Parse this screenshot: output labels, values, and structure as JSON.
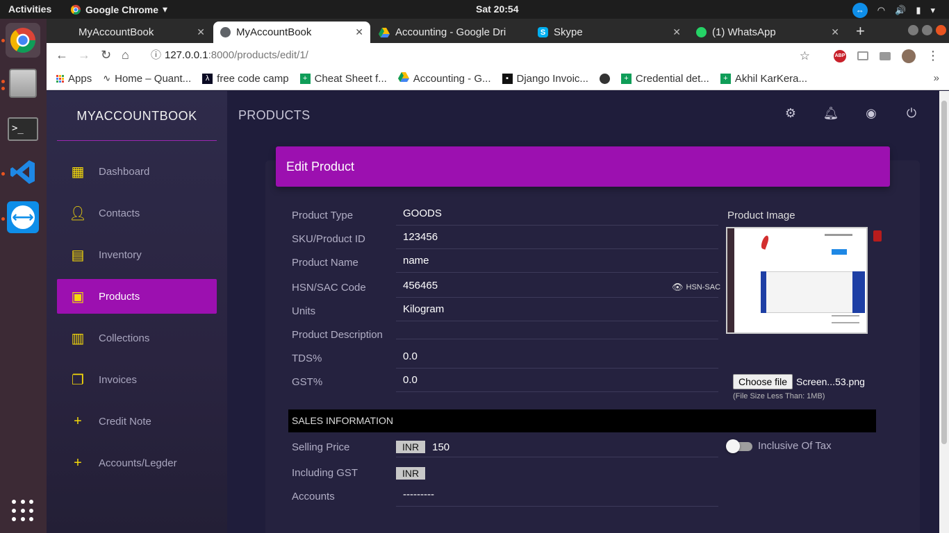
{
  "ubuntu": {
    "activities": "Activities",
    "app_name": "Google Chrome",
    "clock": "Sat 20:54"
  },
  "tabs": [
    {
      "title": "MyAccountBook",
      "icon": "blank-page-icon",
      "active": false
    },
    {
      "title": "MyAccountBook",
      "icon": "globe-icon",
      "active": true
    },
    {
      "title": "Accounting - Google Dri",
      "icon": "google-drive-icon",
      "active": false
    },
    {
      "title": "Skype",
      "icon": "skype-icon",
      "active": false
    },
    {
      "title": "(1) WhatsApp",
      "icon": "whatsapp-icon",
      "active": false
    }
  ],
  "omnibox": {
    "host": "127.0.0.1",
    "path": ":8000/products/edit/1/"
  },
  "bookmarks": [
    {
      "label": "Apps",
      "icon": "apps-grid-icon"
    },
    {
      "label": "Home – Quant...",
      "icon": "pulse-icon"
    },
    {
      "label": "free code camp",
      "icon": "fcc-icon"
    },
    {
      "label": "Cheat Sheet f...",
      "icon": "sheets-icon"
    },
    {
      "label": "Accounting - G...",
      "icon": "google-drive-icon"
    },
    {
      "label": "Django Invoic...",
      "icon": "django-icon"
    },
    {
      "label": "",
      "icon": "globe-icon"
    },
    {
      "label": "Credential det...",
      "icon": "sheets-icon"
    },
    {
      "label": "Akhil KarKera...",
      "icon": "sheets-icon"
    }
  ],
  "sidebar": {
    "brand": "MYACCOUNTBOOK",
    "items": [
      {
        "label": "Dashboard",
        "icon": "dashboard-icon",
        "active": false
      },
      {
        "label": "Contacts",
        "icon": "person-icon",
        "active": false
      },
      {
        "label": "Inventory",
        "icon": "inventory-icon",
        "active": false
      },
      {
        "label": "Products",
        "icon": "products-icon",
        "active": true
      },
      {
        "label": "Collections",
        "icon": "collections-icon",
        "active": false
      },
      {
        "label": "Invoices",
        "icon": "invoices-icon",
        "active": false
      },
      {
        "label": "Credit Note",
        "icon": "plus-icon",
        "active": false
      },
      {
        "label": "Accounts/Legder",
        "icon": "plus-icon",
        "active": false
      }
    ]
  },
  "header": {
    "title": "PRODUCTS"
  },
  "form": {
    "title": "Edit Product",
    "fields": [
      {
        "label": "Product Type",
        "value": "GOODS"
      },
      {
        "label": "SKU/Product ID",
        "value": "123456"
      },
      {
        "label": "Product Name",
        "value": "name"
      },
      {
        "label": "HSN/SAC Code",
        "value": "456465"
      },
      {
        "label": "Units",
        "value": "Kilogram"
      },
      {
        "label": "Product Description",
        "value": ""
      },
      {
        "label": "TDS%",
        "value": "0.0"
      },
      {
        "label": "GST%",
        "value": "0.0"
      }
    ],
    "hsn_tag": "HSN-SAC",
    "image_label": "Product Image",
    "file_button": "Choose file",
    "file_name": "Screen...53.png",
    "file_note": "(File Size Less Than: 1MB)",
    "sales_heading": "SALES INFORMATION",
    "selling_price_label": "Selling Price",
    "selling_currency": "INR",
    "selling_price_value": "150",
    "including_gst_label": "Including GST",
    "including_gst_currency": "INR",
    "accounts_label": "Accounts",
    "accounts_value": "---------",
    "inclusive_tax_label": "Inclusive Of Tax"
  },
  "colors": {
    "accent": "#9c10b0",
    "icon_yellow": "#f5d90a",
    "background": "#1f1d3b"
  }
}
